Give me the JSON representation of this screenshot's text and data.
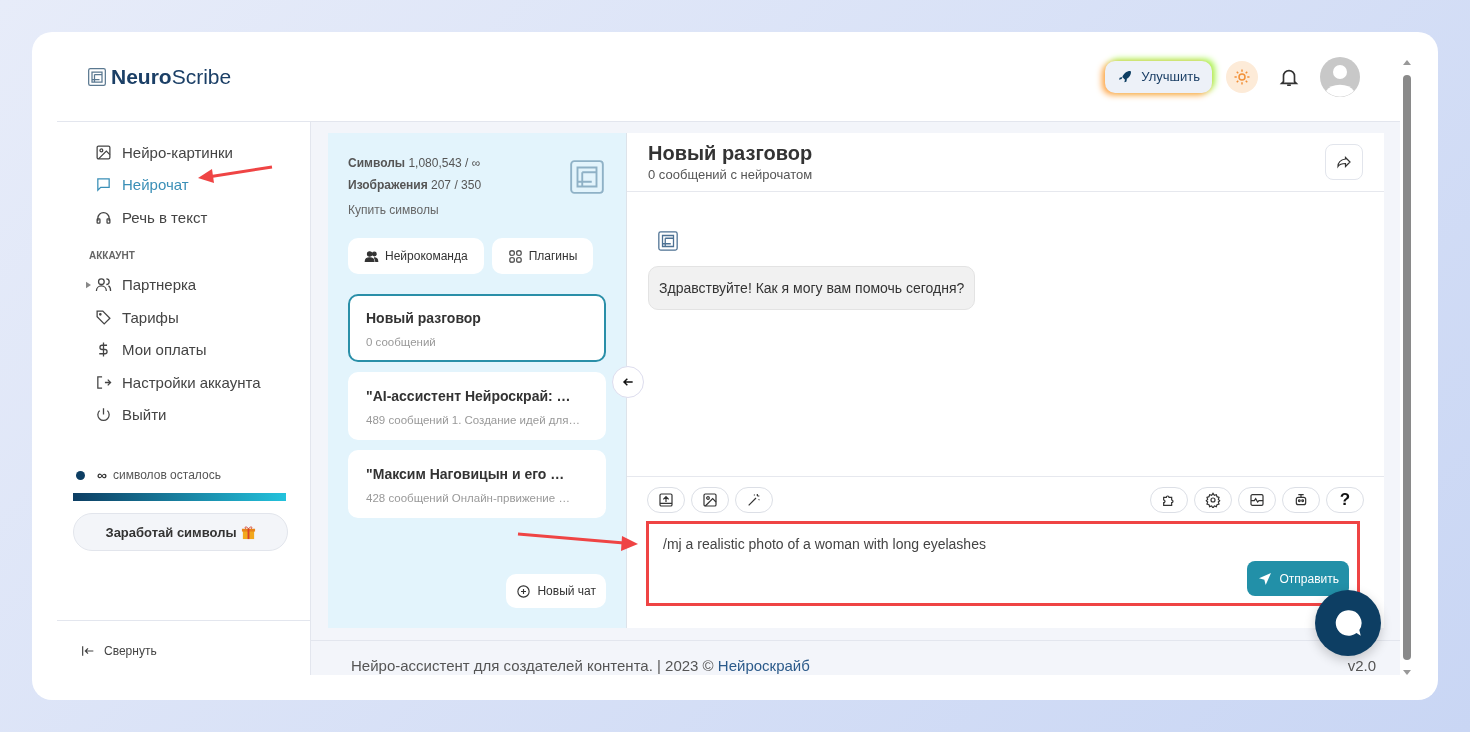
{
  "brand": "**Neuro**Scribe",
  "header": {
    "upgrade_button": "Улучшить"
  },
  "sidebar": {
    "items": [
      {
        "label": "Нейро-картинки",
        "selected": false
      },
      {
        "label": "Нейрочат",
        "selected": true
      },
      {
        "label": "Речь в текст",
        "selected": false
      }
    ],
    "section": "АККАУНТ",
    "account_items": [
      {
        "kind": "group",
        "label": "Партнерка",
        "expanded": false
      },
      {
        "kind": "link",
        "label": "Тарифы"
      },
      {
        "kind": "link",
        "label": "Мои оплаты"
      },
      {
        "kind": "link",
        "label": "Настройки аккаунта"
      },
      {
        "kind": "link",
        "label": "Выйти"
      }
    ],
    "symbols": {
      "amount": "∞",
      "label": "символов осталось",
      "level": 1
    },
    "earn_button": "Заработай символы",
    "collapse": "Свернуть"
  },
  "stats": [
    {
      "text": "**Символы** 1,080,543 / ∞"
    },
    {
      "text": "**Изображения** 207 / 350"
    }
  ],
  "buy_link": "Купить символы",
  "panel_buttons": [
    "Нейрокоманда",
    "Плагины"
  ],
  "conversations": [
    {
      "title": "Новый разговор",
      "meta": "0 сообщений",
      "selected": true
    },
    {
      "title": "\"AI-ассистент Нейроскрай: …",
      "meta": "489 сообщений 1. Создание идей для…",
      "selected": false
    },
    {
      "title": "\"Максим Наговицын и его …",
      "meta": "428 сообщений Онлайн-првижение …",
      "selected": false
    }
  ],
  "new_chat": "Новый чат",
  "chat": {
    "title": "Новый разговор",
    "subtitle": "0 сообщений с нейрочатом",
    "messages": [
      "Здравствуйте! Как я могу вам помочь сегодня?"
    ],
    "tools_left": [
      {
        "kind": "icon"
      },
      {
        "kind": "icon"
      },
      {
        "kind": "icon"
      }
    ],
    "tools_right": [
      {
        "kind": "icon"
      },
      {
        "kind": "icon"
      },
      {
        "kind": "icon"
      },
      {
        "kind": "icon"
      },
      {
        "kind": "text",
        "label": "?"
      }
    ],
    "input": "/mj a realistic photo of a woman with long eyelashes",
    "send": "Отправить"
  },
  "footer": {
    "text": "Нейро-ассистент для создателей контента.  | 2023 ©",
    "link": "Нейроскрайб",
    "version": "v2.0"
  }
}
